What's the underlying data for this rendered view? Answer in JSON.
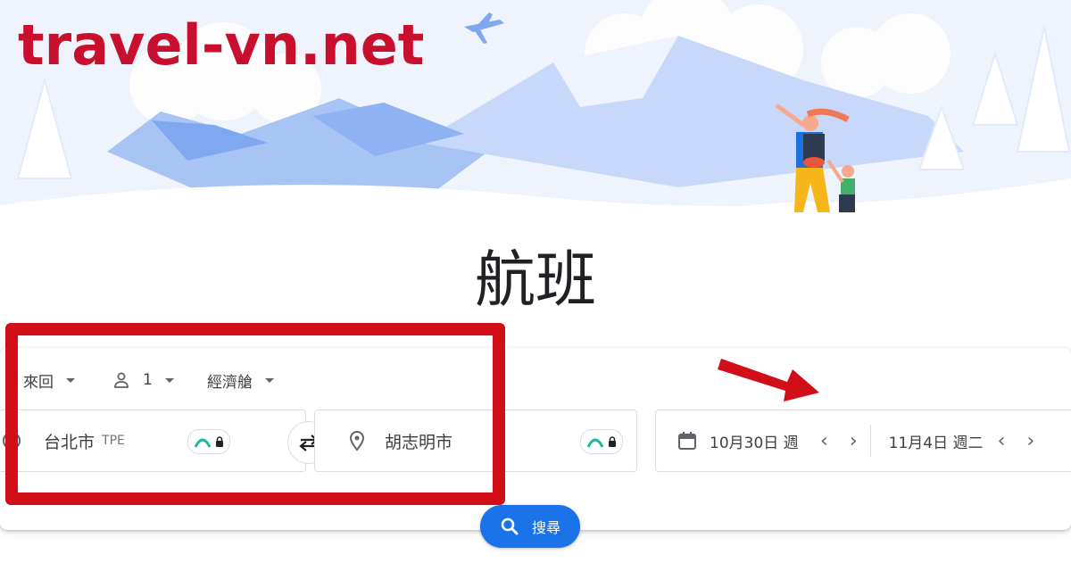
{
  "brand": {
    "text": "travel-vn.net"
  },
  "page_title": "航班",
  "options": {
    "trip_type": "來回",
    "passengers": "1",
    "cabin": "經濟艙"
  },
  "origin": {
    "city": "台北市",
    "code": "TPE"
  },
  "destination": {
    "city": "胡志明市"
  },
  "dates": {
    "depart": "10月30日 週",
    "return": "11月4日 週二"
  },
  "search": {
    "label": "搜尋"
  },
  "colors": {
    "accent": "#1a73e8",
    "brand": "#c8102e",
    "highlight": "#d20f19"
  },
  "icons": {
    "person": "person-icon",
    "pin": "location-pin-icon",
    "calendar": "calendar-icon",
    "swap": "swap-icon",
    "search": "search-icon",
    "lock": "lock-icon"
  }
}
